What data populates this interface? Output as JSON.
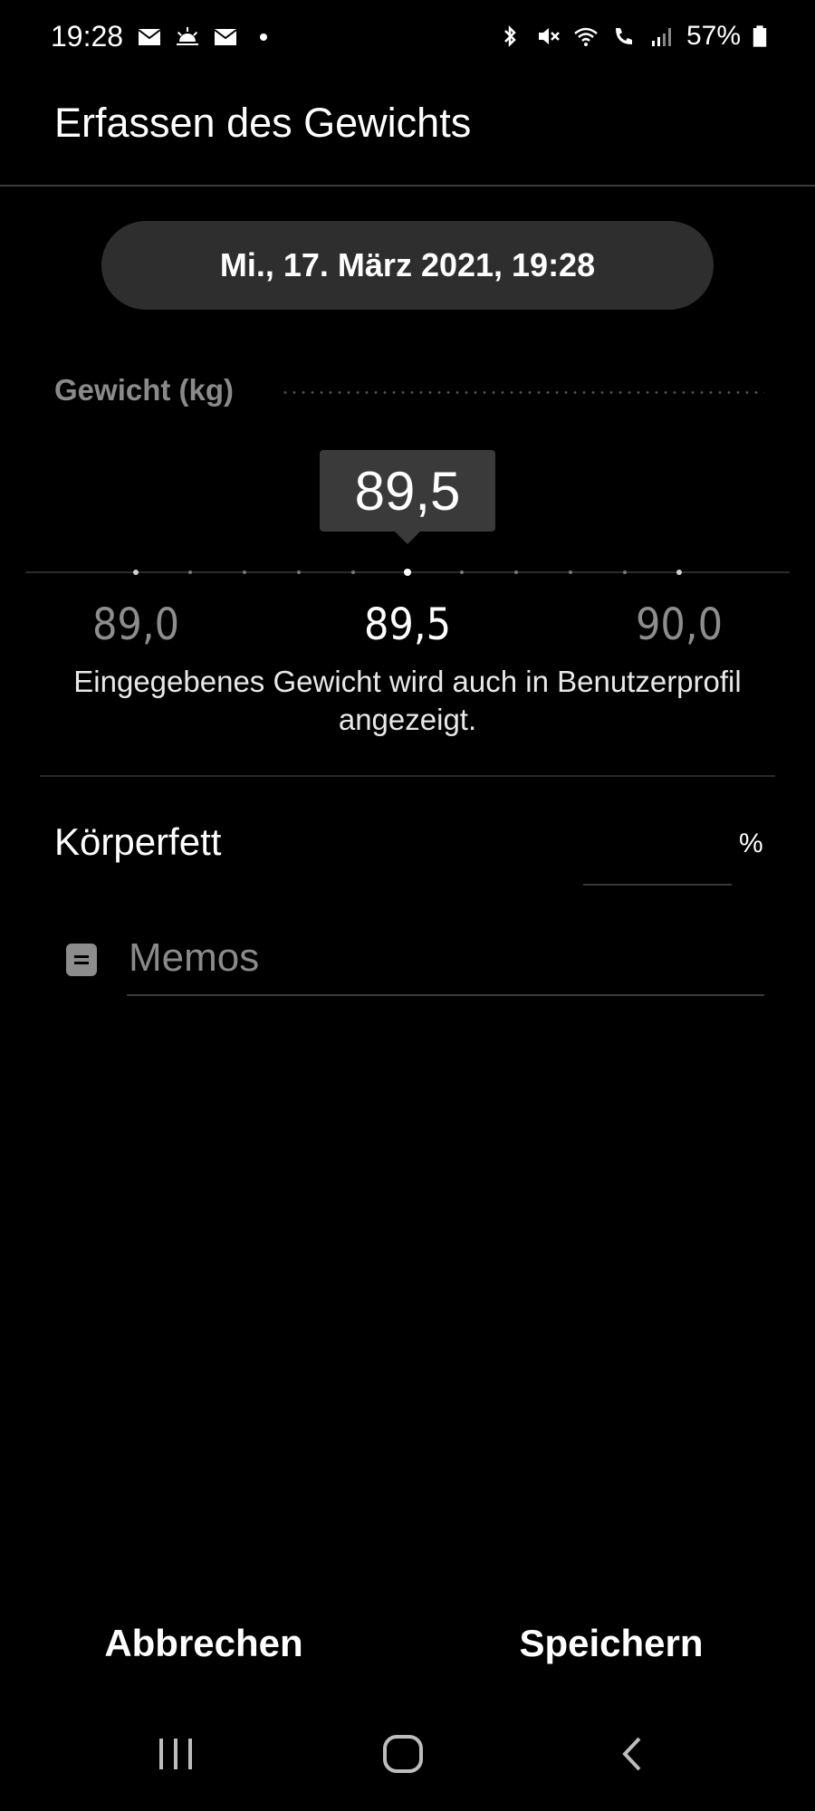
{
  "status_bar": {
    "time": "19:28",
    "battery": "57%",
    "left_icons": [
      "mail-icon",
      "weather-icon",
      "mail-icon",
      "dot-icon"
    ],
    "right_icons": [
      "bluetooth-icon",
      "mute-icon",
      "wifi-icon",
      "wifi-call-icon",
      "signal-icon",
      "battery-icon"
    ]
  },
  "header": {
    "title": "Erfassen des Gewichts"
  },
  "date_time": "Mi., 17. März 2021, 19:28",
  "weight": {
    "label": "Gewicht (kg)",
    "value": "89,5",
    "ruler_labels": [
      "89,0",
      "89,5",
      "90,0"
    ],
    "info": "Eingegebenes Gewicht wird auch in Benutzerprofil angezeigt."
  },
  "body_fat": {
    "label": "Körperfett",
    "value": "",
    "unit": "%"
  },
  "memo": {
    "placeholder": "Memos",
    "value": ""
  },
  "buttons": {
    "cancel": "Abbrechen",
    "save": "Speichern"
  },
  "nav": {
    "recents": "recents-icon",
    "home": "home-icon",
    "back": "back-icon"
  }
}
